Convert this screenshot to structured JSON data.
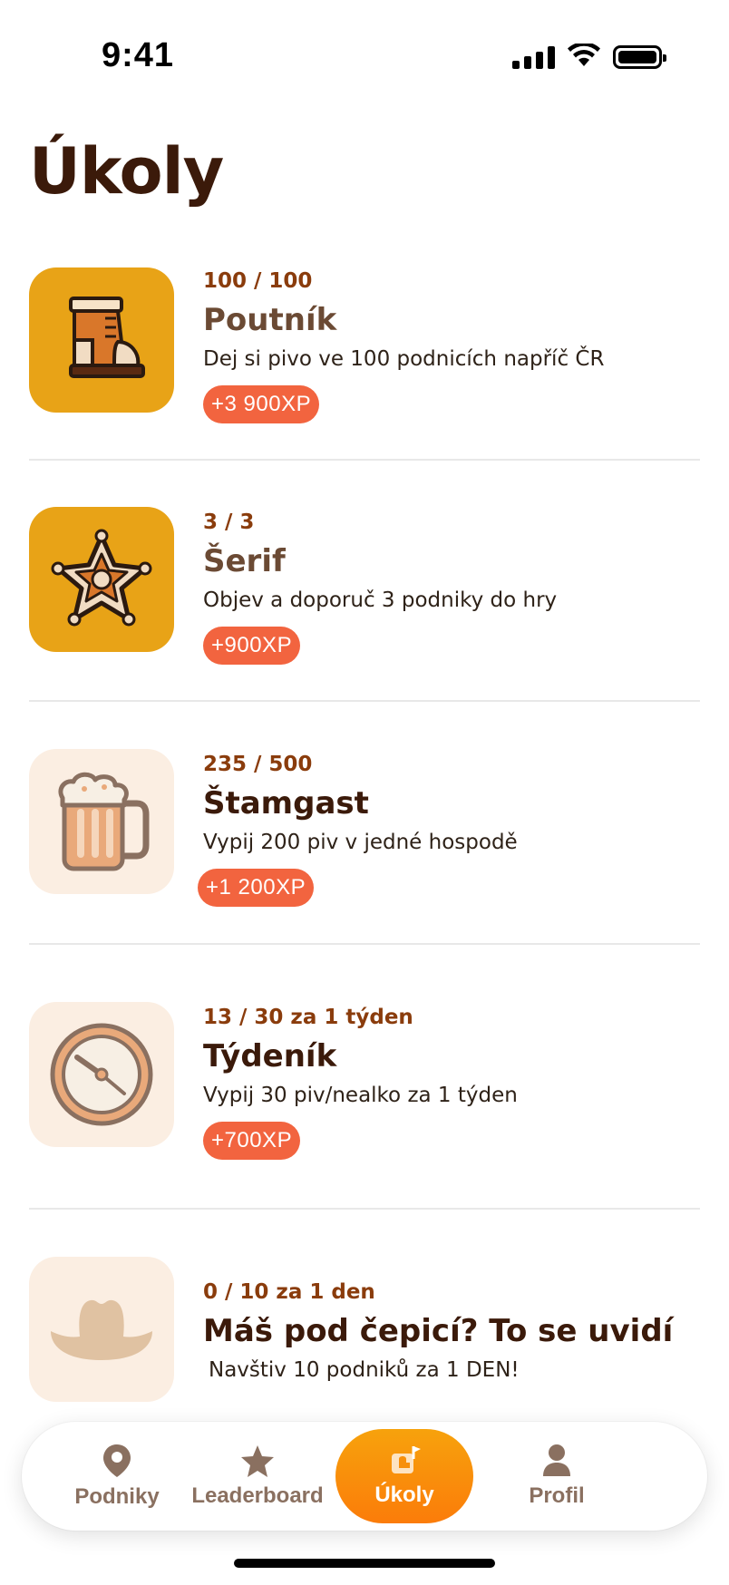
{
  "status_bar": {
    "time": "9:41"
  },
  "title": "Úkoly",
  "tasks": [
    {
      "progress": "100 / 100",
      "name": "Poutník",
      "description": "Dej si pivo ve 100 podnicích napříč ČR",
      "xp": "+3 900XP",
      "icon": "boot-icon"
    },
    {
      "progress": "3 / 3",
      "name": "Šerif",
      "description": "Objev a doporuč 3 podniky do hry",
      "xp": "+900XP",
      "icon": "sheriff-star-icon"
    },
    {
      "progress": "235 / 500",
      "name": "Štamgast",
      "description": "Vypij 200 piv v jedné hospodě",
      "xp": "+1 200XP",
      "icon": "beer-mug-icon"
    },
    {
      "progress": "13 / 30 za 1 týden",
      "name": "Týdeník",
      "description": "Vypij 30 piv/nealko za 1 týden",
      "xp": "+700XP",
      "icon": "clock-icon"
    },
    {
      "progress": "0 / 10 za 1 den",
      "name": "Máš pod čepicí? To se uvidí",
      "description": "Navštiv 10 podniků za 1 DEN!",
      "icon": "cowboy-hat-icon"
    }
  ],
  "tab_bar": {
    "tabs": [
      {
        "label": "Podniky",
        "icon": "map-pin-icon"
      },
      {
        "label": "Leaderboard",
        "icon": "star-icon"
      },
      {
        "label": "Úkoly",
        "icon": "quest-flag-icon",
        "active": true
      },
      {
        "label": "Profil",
        "icon": "person-icon"
      }
    ]
  },
  "colors": {
    "accent_orange": "#fb7c0a",
    "xp_badge": "#f2643f",
    "icon_gold": "#e8a317",
    "icon_cream": "#fbeee2",
    "title_brown": "#3b1a0a"
  }
}
